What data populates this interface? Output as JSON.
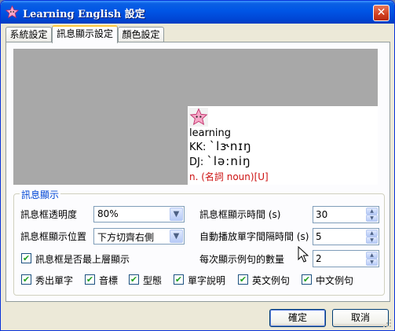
{
  "window": {
    "title": "Learning English 設定",
    "app_icon": "pink-star-icon",
    "close_glyph": "✕"
  },
  "tabs": [
    {
      "label": "系統設定",
      "active": false
    },
    {
      "label": "訊息顯示設定",
      "active": true
    },
    {
      "label": "顏色設定",
      "active": false
    }
  ],
  "preview": {
    "icon": "pink-star-icon",
    "word": "learning",
    "kk_label": "KK:",
    "kk_phonetic": "ˋlɝnɪŋ",
    "dj_label": "DJ:",
    "dj_phonetic": "ˋlə:niŋ",
    "meaning": "n. (名詞 noun)[U]",
    "meaning_color": "#cc1111"
  },
  "group": {
    "legend": "訊息顯示",
    "legend_color": "#0046d5",
    "opacity_label": "訊息框透明度",
    "opacity_value": "80%",
    "position_label": "訊息框顯示位置",
    "position_value": "下方切齊右側",
    "ontop_label": "訊息框是否最上層顯示",
    "ontop_checked": true,
    "duration_label": "訊息框顯示時間 (s)",
    "duration_value": "30",
    "interval_label": "自動播放單字間隔時間 (s)",
    "interval_value": "5",
    "examples_label": "每次顯示例句的數量",
    "examples_value": "2",
    "options": [
      {
        "label": "秀出單字",
        "checked": true
      },
      {
        "label": "音標",
        "checked": true
      },
      {
        "label": "型態",
        "checked": true
      },
      {
        "label": "單字說明",
        "checked": true
      },
      {
        "label": "英文例句",
        "checked": true
      },
      {
        "label": "中文例句",
        "checked": true
      }
    ]
  },
  "buttons": {
    "ok": "確定",
    "cancel": "取消"
  },
  "glyphs": {
    "check": "✔",
    "dropdown": "▼",
    "spin_up": "▲",
    "spin_down": "▼"
  }
}
